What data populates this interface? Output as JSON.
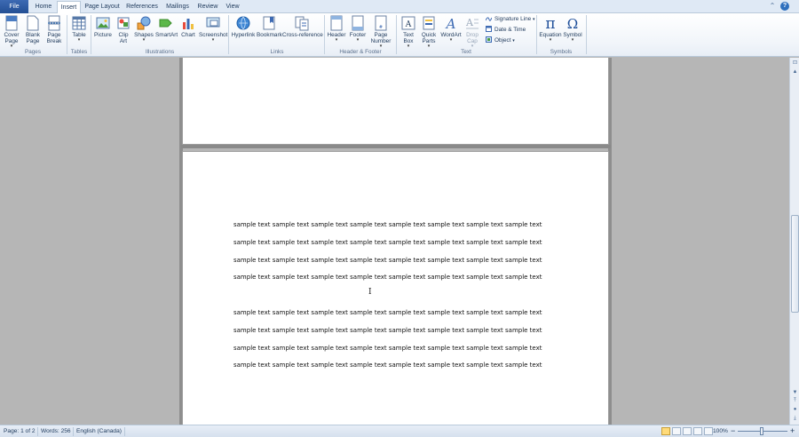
{
  "tabs": [
    "File",
    "Home",
    "Insert",
    "Page Layout",
    "References",
    "Mailings",
    "Review",
    "View"
  ],
  "active_tab": "Insert",
  "window_controls": {
    "minimize_ribbon": "⌃",
    "help": "?"
  },
  "ribbon": {
    "pages": {
      "label": "Pages",
      "cover_page": [
        "Cover",
        "Page"
      ],
      "blank_page": [
        "Blank",
        "Page"
      ],
      "page_break": [
        "Page",
        "Break"
      ]
    },
    "tables": {
      "label": "Tables",
      "table": "Table"
    },
    "illustrations": {
      "label": "Illustrations",
      "picture": "Picture",
      "clip_art": [
        "Clip",
        "Art"
      ],
      "shapes": "Shapes",
      "smartart": "SmartArt",
      "chart": "Chart",
      "screenshot": "Screenshot"
    },
    "links": {
      "label": "Links",
      "hyperlink": "Hyperlink",
      "bookmark": "Bookmark",
      "cross_reference": "Cross-reference"
    },
    "header_footer": {
      "label": "Header & Footer",
      "header": "Header",
      "footer": "Footer",
      "page_number": [
        "Page",
        "Number"
      ]
    },
    "text": {
      "label": "Text",
      "text_box": [
        "Text",
        "Box"
      ],
      "quick_parts": [
        "Quick",
        "Parts"
      ],
      "wordart": "WordArt",
      "drop_cap": [
        "Drop",
        "Cap"
      ],
      "signature_line": "Signature Line",
      "date_time": "Date & Time",
      "object": "Object"
    },
    "symbols": {
      "label": "Symbols",
      "equation": "Equation",
      "symbol": "Symbol"
    }
  },
  "document": {
    "paragraph1": [
      "sample text sample text sample text sample text sample text sample text sample text sample text",
      "sample text sample text sample text sample text sample text sample text sample text sample text",
      "sample text sample text sample text sample text sample text sample text sample text sample text",
      "sample text sample text sample text sample text sample text sample text sample text sample text"
    ],
    "paragraph2": [
      "sample text sample text sample text sample text sample text sample text sample text sample text",
      "sample text sample text sample text sample text sample text sample text sample text sample text",
      "sample text sample text sample text sample text sample text sample text sample text sample text",
      "sample text sample text sample text sample text sample text sample text sample text sample text"
    ]
  },
  "status": {
    "page": "Page: 1 of 2",
    "words": "Words: 256",
    "language": "English (Canada)",
    "zoom": "100%",
    "zoom_minus": "−",
    "zoom_plus": "+"
  },
  "colors": {
    "file_tab": "#2b579a",
    "ribbon_bg": "#f1f5fa",
    "doc_bg": "#b6b6b6"
  }
}
